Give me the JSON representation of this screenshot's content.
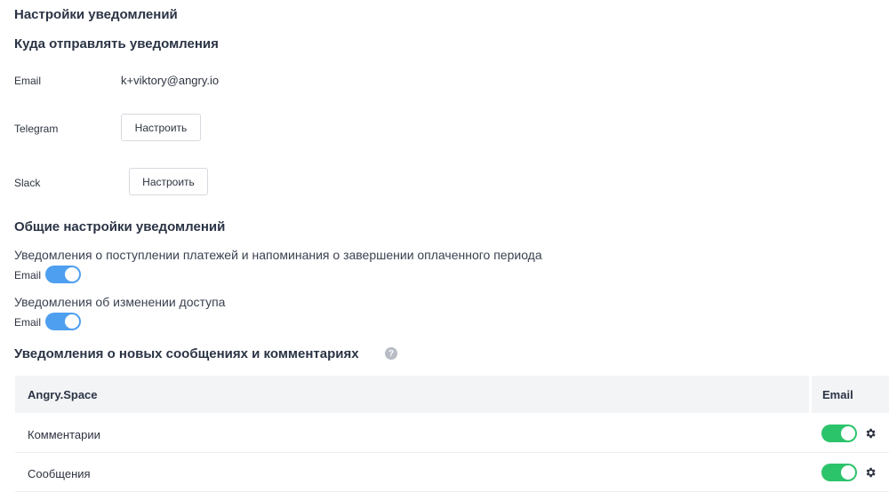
{
  "page": {
    "title": "Настройки уведомлений"
  },
  "destinations": {
    "heading": "Куда отправлять уведомления",
    "email_label": "Email",
    "email_value": "k+viktory@angry.io",
    "telegram_label": "Telegram",
    "telegram_button": "Настроить",
    "slack_label": "Slack",
    "slack_button": "Настроить"
  },
  "general": {
    "heading": "Общие настройки уведомлений",
    "items": [
      {
        "description": "Уведомления о поступлении платежей и напоминания о завершении оплаченного периода",
        "channel": "Email",
        "enabled": true
      },
      {
        "description": "Уведомления об изменении доступа",
        "channel": "Email",
        "enabled": true
      }
    ]
  },
  "messages": {
    "heading": "Уведомления о новых сообщениях и комментариях",
    "help_icon": "question-circle-icon",
    "columns": [
      "Angry.Space",
      "Email"
    ],
    "rows": [
      {
        "name": "Комментарии",
        "email_enabled": true,
        "settings_icon": "gear-icon"
      },
      {
        "name": "Сообщения",
        "email_enabled": true,
        "settings_icon": "gear-icon"
      }
    ]
  },
  "colors": {
    "toggle_blue": "#4e9ff0",
    "toggle_green": "#2cc46b",
    "header_bg": "#f3f4f6"
  }
}
